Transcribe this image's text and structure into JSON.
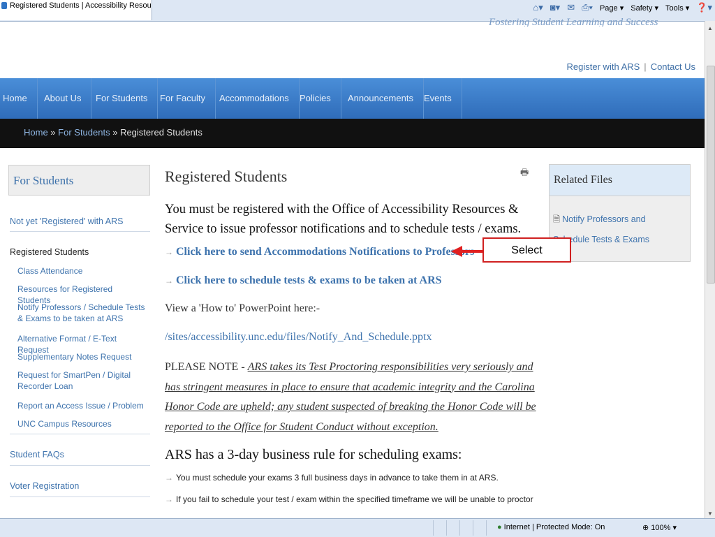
{
  "browser": {
    "tab_title": "Registered Students | Accessibility Resources & S...",
    "commands": [
      "Page ▾",
      "Safety ▾",
      "Tools ▾"
    ]
  },
  "header": {
    "tagline": "Fostering Student Learning and Success",
    "links": [
      "Register with ARS",
      "Contact Us"
    ]
  },
  "nav": {
    "items": [
      "Home",
      "About Us",
      "For Students",
      "For Faculty",
      "Accommodations",
      "Policies",
      "Announcements",
      "Events"
    ]
  },
  "breadcrumb": {
    "home": "Home",
    "sep": " » ",
    "parent": "For Students",
    "current": "Registered Students"
  },
  "sidebar": {
    "heading": "For Students",
    "not_registered": "Not yet 'Registered' with ARS",
    "registered": "Registered Students",
    "sub_items": [
      "Class Attendance",
      "Resources for Registered Students",
      "Notify Professors / Schedule Tests & Exams to be taken at ARS",
      "Alternative Format / E-Text Request",
      "Supplementary Notes Request",
      "Request for SmartPen / Digital Recorder Loan",
      "Report an Access Issue / Problem",
      "UNC Campus Resources"
    ],
    "faqs": "Student FAQs",
    "voter": "Voter Registration"
  },
  "main": {
    "title": "Registered Students",
    "intro": "You must be registered with the Office of Accessibility Resources & Service to issue professor notifications and to schedule tests / exams.",
    "link_notify": "Click here to send Accommodations Notifications to Professors",
    "link_schedule": "Click here to schedule tests & exams to be taken at ARS",
    "howto": "View a 'How to' PowerPoint here:-",
    "pptx_path": "/sites/accessibility.unc.edu/files/Notify_And_Schedule.pptx",
    "note_label": "PLEASE NOTE - ",
    "note_text": "ARS takes its Test Proctoring responsibilities very seriously and has stringent measures in place to ensure that academic integrity and the Carolina Honor Code are upheld; any student suspected of breaking the Honor Code will be reported to the Office for Student Conduct without exception.",
    "rule_heading": "ARS has a 3-day business rule for scheduling exams:",
    "bullet1": "You must schedule your exams 3 full business days in advance to take them in at ARS.",
    "bullet2": "If you fail to schedule your test / exam within the specified timeframe we will be unable to proctor"
  },
  "related_files": {
    "heading": "Related Files",
    "link": "Notify Professors and Schedule Tests & Exams"
  },
  "annotation": {
    "label": "Select"
  },
  "status_bar": {
    "zone": "Internet | Protected Mode: On",
    "zoom": "100%"
  },
  "colors": {
    "nav_blue": "#2f6cb9",
    "link_blue": "#3e73ad",
    "breadcrumb_bg": "#111111",
    "annotation_red": "#e02020"
  }
}
